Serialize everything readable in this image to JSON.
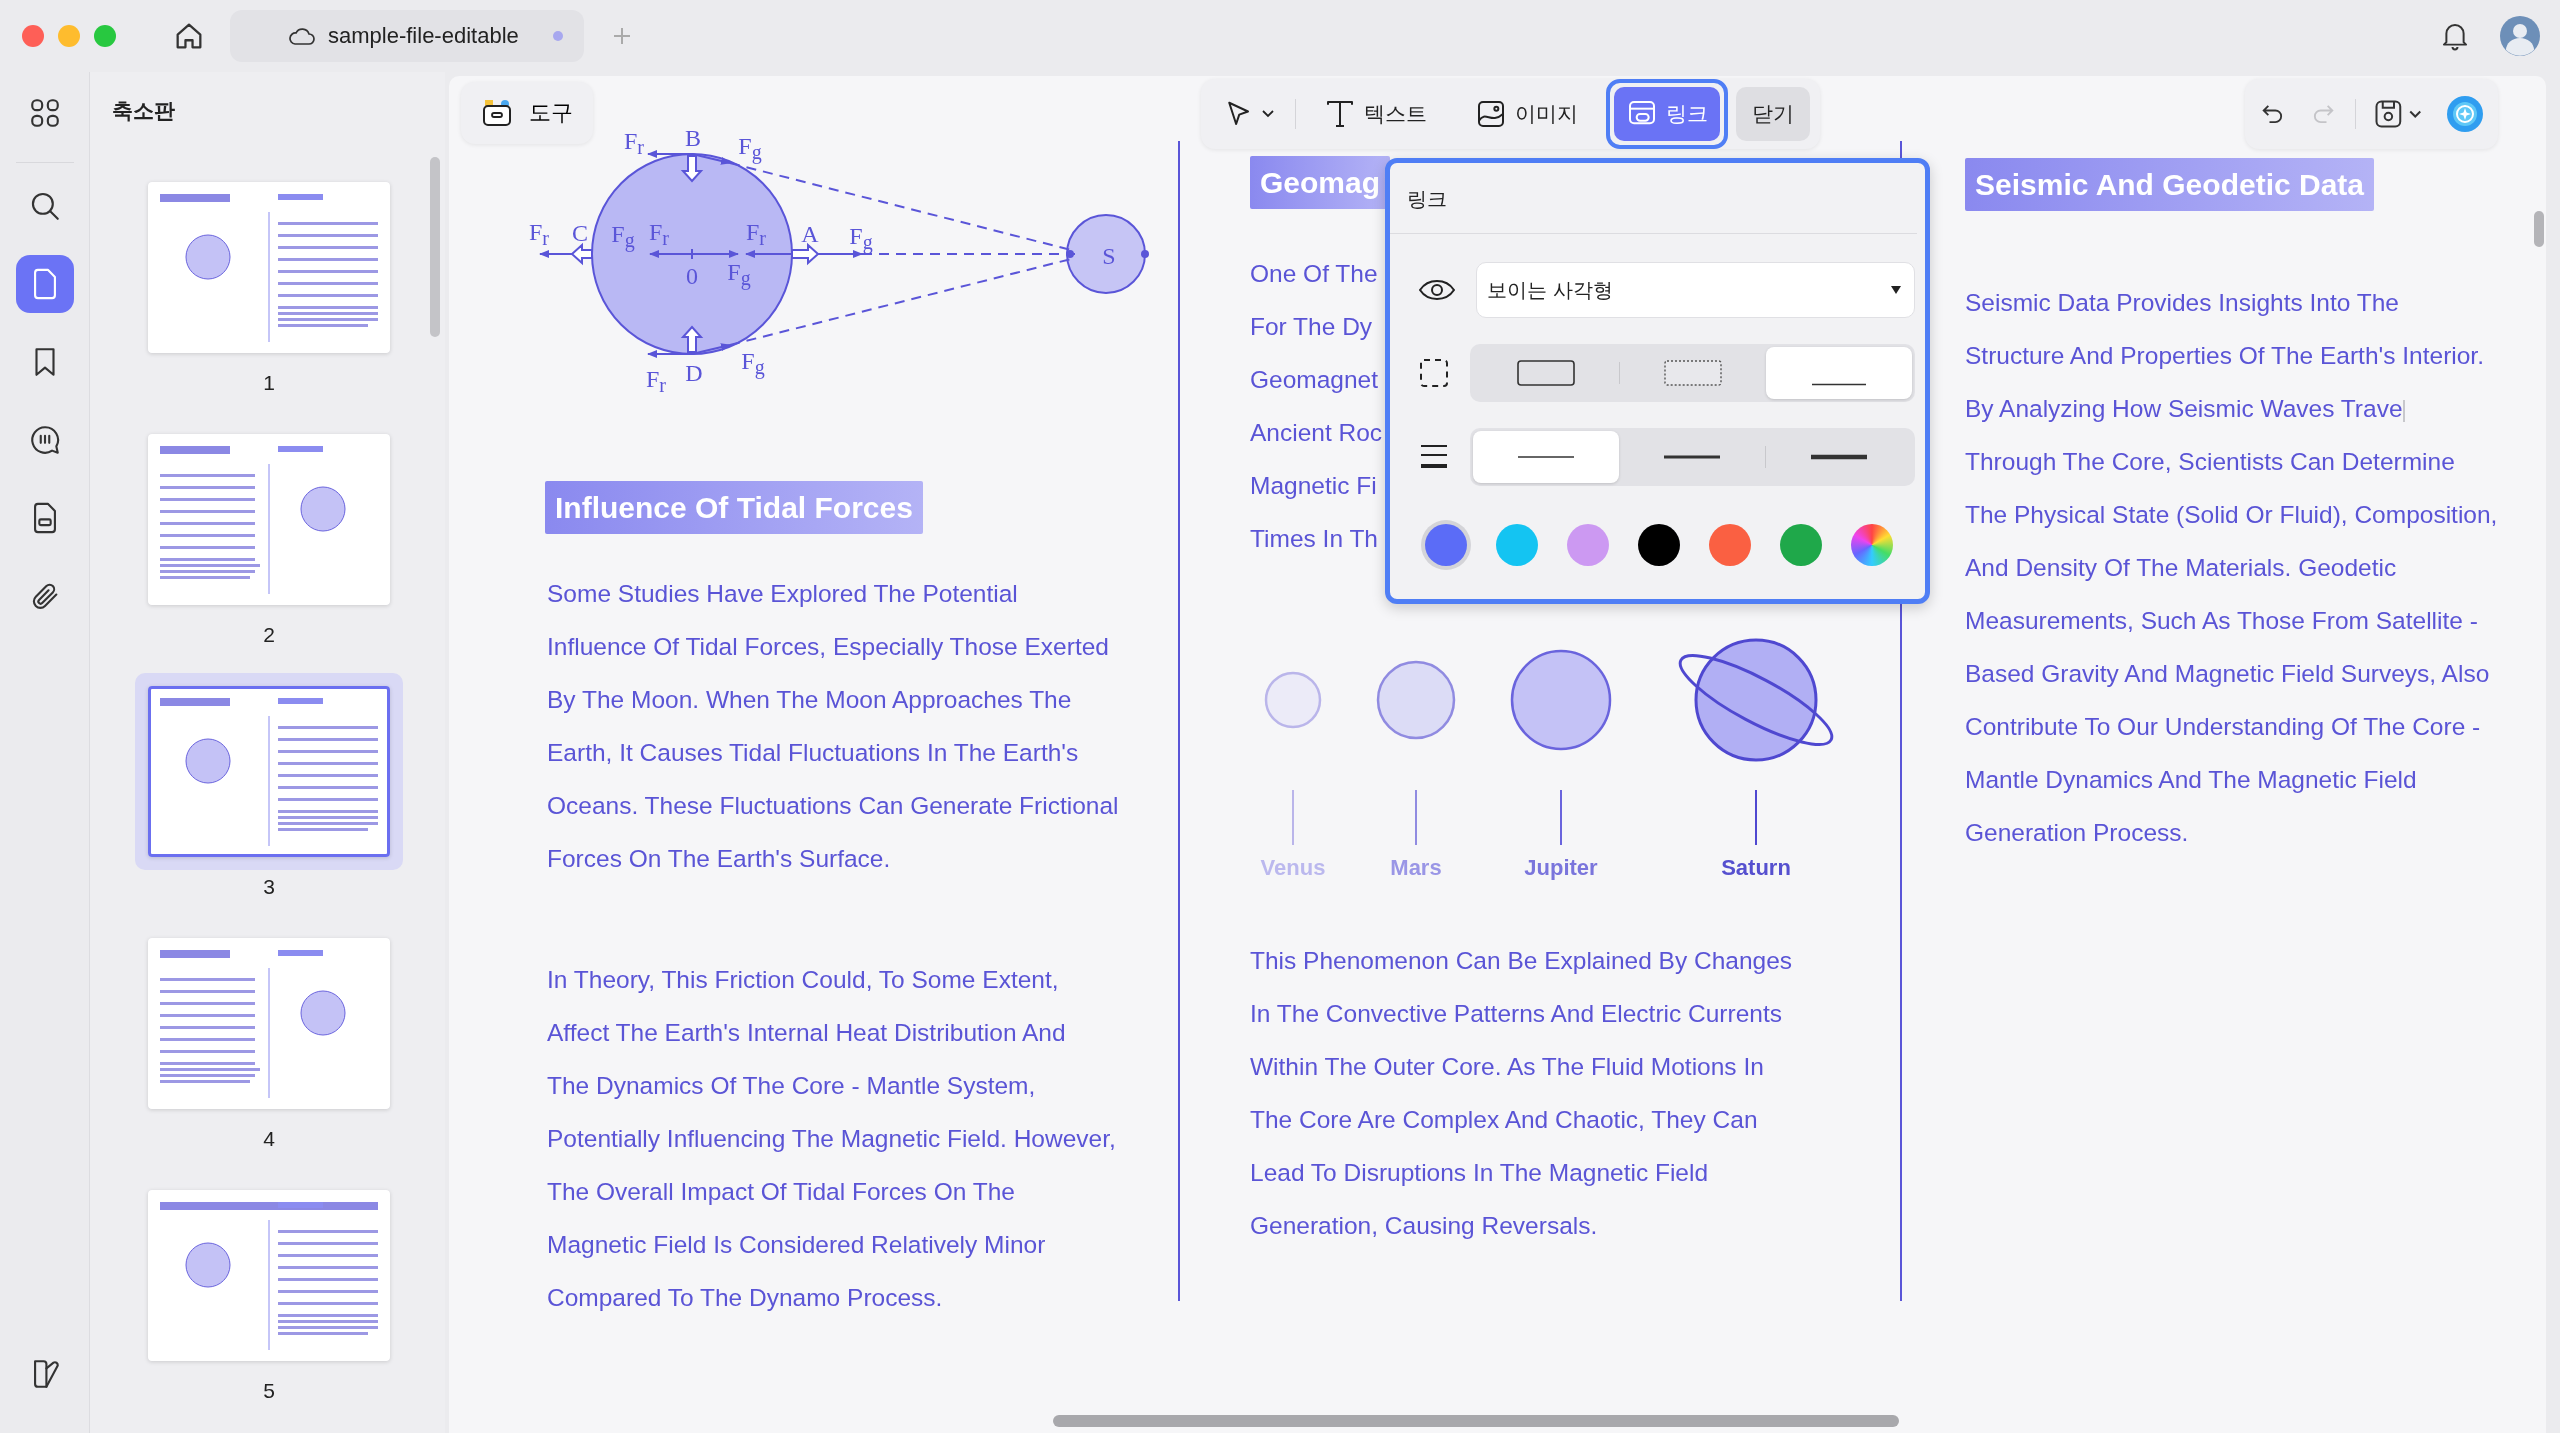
{
  "window": {
    "tab_title": "sample-file-editable",
    "modified": true
  },
  "rail": [
    {
      "kind": "apps",
      "selected": false
    },
    {
      "kind": "search",
      "selected": false
    },
    {
      "kind": "pages",
      "selected": true
    },
    {
      "kind": "bookmark",
      "selected": false
    },
    {
      "kind": "comment",
      "selected": false
    },
    {
      "kind": "form",
      "selected": false
    },
    {
      "kind": "attachment",
      "selected": false
    },
    {
      "kind": "layers",
      "selected": false
    }
  ],
  "thumbnails": {
    "title": "축소판",
    "pages": [
      {
        "label": "1",
        "selected": false
      },
      {
        "label": "2",
        "selected": false
      },
      {
        "label": "3",
        "selected": true
      },
      {
        "label": "4",
        "selected": false
      },
      {
        "label": "5",
        "selected": false
      }
    ]
  },
  "toolbar": {
    "tools_button": "도구",
    "tools": [
      {
        "kind": "select",
        "selected": false
      },
      {
        "kind": "text",
        "label": "텍스트",
        "selected": false
      },
      {
        "kind": "image",
        "label": "이미지",
        "selected": false
      },
      {
        "kind": "link",
        "label": "링크",
        "selected": true
      }
    ],
    "close_button": "닫기",
    "actions": [
      {
        "kind": "undo",
        "disabled": false
      },
      {
        "kind": "redo",
        "disabled": true
      },
      {
        "kind": "save",
        "disabled": false
      },
      {
        "kind": "assistant"
      }
    ]
  },
  "link_popup": {
    "title": "링크",
    "appearance": "보이는 사각형",
    "border_styles": [
      {
        "kind": "solid",
        "selected": false
      },
      {
        "kind": "dotted",
        "selected": false
      },
      {
        "kind": "underline",
        "selected": true
      }
    ],
    "thickness": [
      {
        "kind": "thin",
        "selected": true
      },
      {
        "kind": "medium",
        "selected": false
      },
      {
        "kind": "thick",
        "selected": false
      }
    ],
    "colors": [
      {
        "kind": "solid",
        "color": "#5b6cf7",
        "selected": true
      },
      {
        "kind": "solid",
        "color": "#14c4f2",
        "selected": false
      },
      {
        "kind": "solid",
        "color": "#cc99f2",
        "selected": false
      },
      {
        "kind": "solid",
        "color": "#000000",
        "selected": false
      },
      {
        "kind": "solid",
        "color": "#fa6042",
        "selected": false
      },
      {
        "kind": "solid",
        "color": "#1fa84a",
        "selected": false
      },
      {
        "kind": "spectrum",
        "selected": false
      }
    ]
  },
  "document": {
    "left": {
      "diagram_labels": [
        "F$_{r}$",
        "B",
        "F$_{g}$",
        "F$_{r}$",
        "C",
        "F$_{g}$",
        "F$_{r}$",
        "0",
        "F$_{r}$",
        "F$_{g}$",
        "A",
        "F$_{g}$",
        "S",
        "F$_{r}$",
        "D",
        "F$_{g}$"
      ],
      "heading": "Influence Of Tidal Forces",
      "paragraphs": [
        [
          "Some Studies Have Explored The Potential",
          "Influence Of Tidal Forces, Especially Those Exerted",
          "By The Moon. When The Moon Approaches The",
          "Earth, It Causes Tidal Fluctuations In The Earth's",
          "Oceans. These Fluctuations Can Generate Frictional",
          "Forces On The Earth's Surface."
        ],
        [
          "In Theory, This Friction Could, To Some Extent,",
          "Affect The Earth's Internal Heat Distribution And",
          "The Dynamics Of The Core - Mantle System,",
          "Potentially Influencing The Magnetic Field. However,",
          "The Overall Impact Of Tidal Forces On The",
          "Magnetic Field Is Considered Relatively Minor",
          "Compared To The Dynamo Process."
        ]
      ]
    },
    "middle": {
      "heading": "Geomag",
      "visible_lines": [
        "One Of The",
        "For The Dy",
        "Geomagnet",
        "Ancient Roc",
        "Magnetic Fi",
        "Times In Th"
      ],
      "planets": [
        {
          "name": "Venus",
          "kind": "plain"
        },
        {
          "name": "Mars",
          "kind": "plain"
        },
        {
          "name": "Jupiter",
          "kind": "plain"
        },
        {
          "name": "Saturn",
          "kind": "ringed"
        }
      ],
      "paragraph": [
        "This Phenomenon Can Be Explained By Changes",
        "In The Convective Patterns And Electric Currents",
        "Within The Outer Core. As The Fluid Motions In",
        "The Core Are Complex And Chaotic, They Can",
        "Lead To Disruptions In The Magnetic Field",
        "Generation, Causing Reversals."
      ]
    },
    "right": {
      "heading": "Seismic And Geodetic Data",
      "paragraph": [
        {
          "text": "Seismic Data Provides Insights Into The",
          "cursor": false
        },
        {
          "text": "Structure And Properties Of The Earth's Interior.",
          "cursor": false
        },
        {
          "text": "By Analyzing How Seismic Waves Trave",
          "cursor": true
        },
        {
          "text": "Through The Core, Scientists Can Determine",
          "cursor": false
        },
        {
          "text": "The Physical State (Solid Or Fluid), Composition,",
          "cursor": false
        },
        {
          "text": "And Density Of The Materials. Geodetic",
          "cursor": false
        },
        {
          "text": "Measurements, Such As Those From Satellite -",
          "cursor": false
        },
        {
          "text": "Based Gravity And Magnetic Field Surveys, Also",
          "cursor": false
        },
        {
          "text": "Contribute To Our Understanding Of The Core -",
          "cursor": false
        },
        {
          "text": "Mantle Dynamics And The Magnetic Field",
          "cursor": false
        },
        {
          "text": "Generation Process.",
          "cursor": false
        }
      ]
    }
  }
}
